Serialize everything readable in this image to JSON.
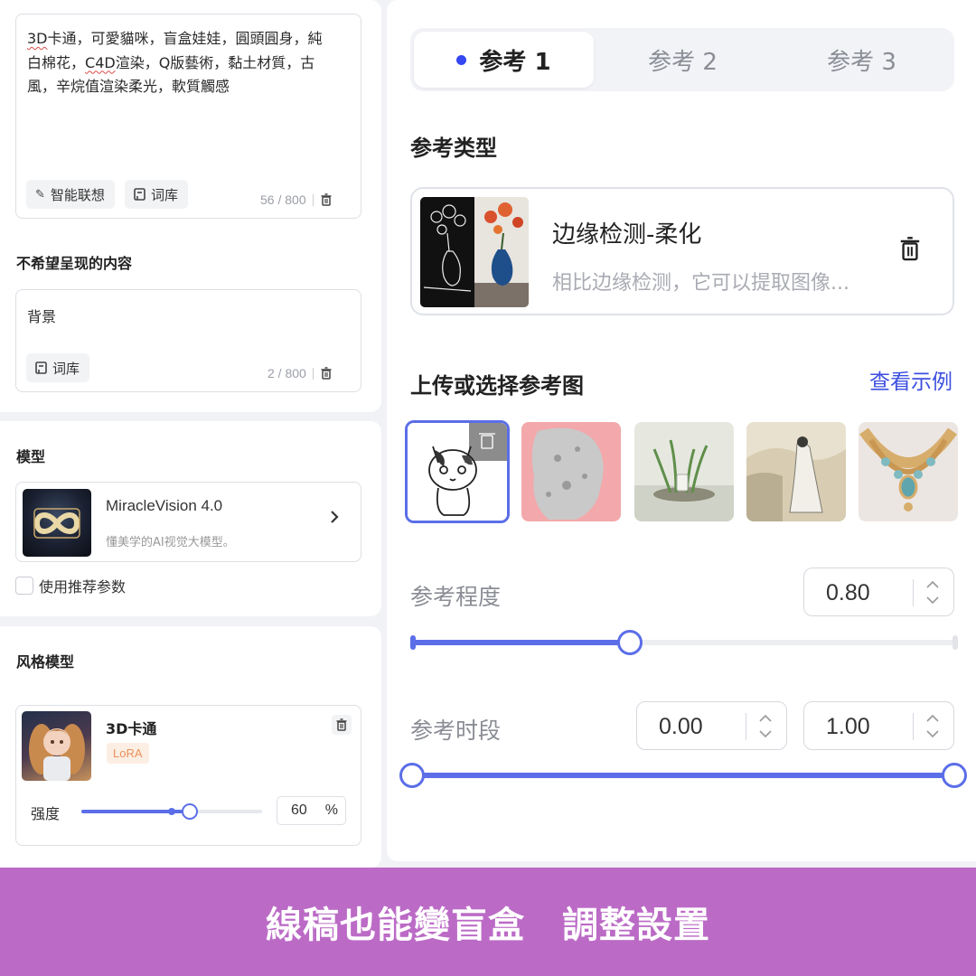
{
  "prompt": {
    "parts": [
      {
        "text": "3D",
        "squiggle": true
      },
      {
        "text": "卡通，可愛貓咪，盲盒娃娃，圓頭圓身，純白棉花，",
        "squiggle": false
      },
      {
        "text": "C4D",
        "squiggle": true
      },
      {
        "text": "渲染，Q版藝術，黏土材質，古風，辛烷值渲染柔光，軟質觸感",
        "squiggle": false
      }
    ],
    "smart_assoc_label": "智能联想",
    "lexicon_label": "词库",
    "counter": "56 / 800"
  },
  "negative": {
    "title": "不希望呈现的内容",
    "text": "背景",
    "lexicon_label": "词库",
    "counter": "2 / 800"
  },
  "model": {
    "title": "模型",
    "name": "MiracleVision 4.0",
    "desc": "懂美学的AI视觉大模型。",
    "use_recommended": "使用推荐参数"
  },
  "style_model": {
    "title": "风格模型",
    "name": "3D卡通",
    "tag": "LoRA",
    "strength_label": "强度",
    "strength_value": "60",
    "strength_unit": "%",
    "strength_fraction": 0.6
  },
  "reference": {
    "tabs": [
      {
        "label": "参考 1",
        "active": true
      },
      {
        "label": "参考 2",
        "active": false
      },
      {
        "label": "参考 3",
        "active": false
      }
    ],
    "type_title": "参考类型",
    "type_name": "边缘检测-柔化",
    "type_desc": "相比边缘检测，它可以提取图像...",
    "upload_title": "上传或选择参考图",
    "see_example": "查看示例",
    "degree_label": "参考程度",
    "degree_value": "0.80",
    "degree_fraction": 0.4,
    "period_label": "参考时段",
    "period_start": "0.00",
    "period_end": "1.00"
  },
  "banner": {
    "text": "線稿也能變盲盒　調整設置"
  },
  "colors": {
    "accent": "#5b6ee8",
    "banner": "#bb6bc6",
    "link": "#3c4fe0",
    "lora_tag": "#e8915b"
  },
  "icons": [
    "wand-icon",
    "book-icon",
    "trash-icon",
    "chevron-right-icon",
    "stepper-arrows-icon"
  ]
}
